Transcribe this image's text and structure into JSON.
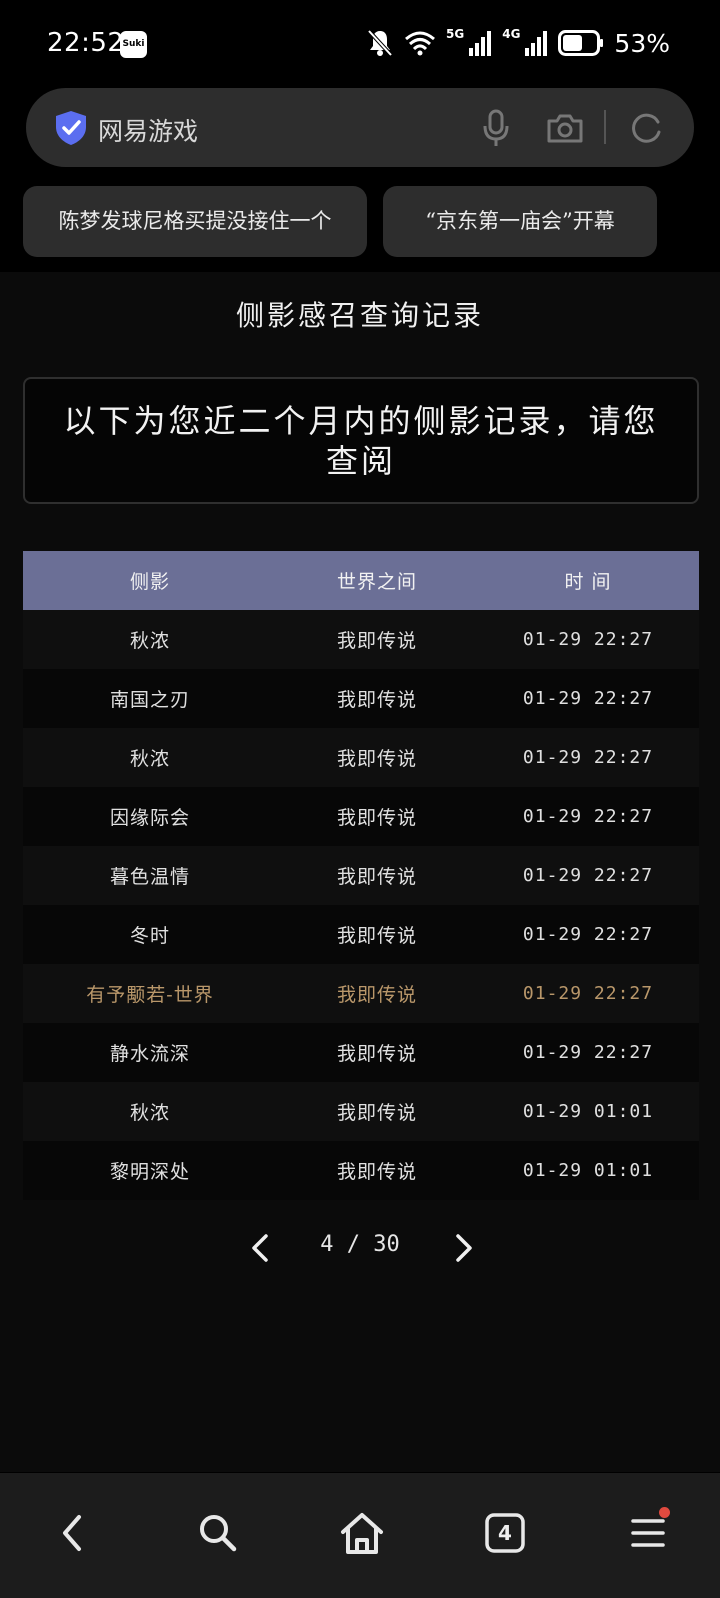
{
  "status_bar": {
    "time": "22:52",
    "app_badge": "Suki",
    "network_5g": "5G",
    "network_4g": "4G",
    "battery": "53%"
  },
  "search": {
    "text": "网易游戏"
  },
  "chips": [
    "陈梦发球尼格买提没接住一个",
    "“京东第一庙会”开幕"
  ],
  "page": {
    "title": "侧影感召查询记录",
    "notice": "以下为您近二个月内的侧影记录，请您查阅"
  },
  "table": {
    "headers": [
      "侧影",
      "世界之间",
      "时 间"
    ],
    "rows": [
      [
        "秋浓",
        "我即传说",
        "01-29 22:27"
      ],
      [
        "南国之刃",
        "我即传说",
        "01-29 22:27"
      ],
      [
        "秋浓",
        "我即传说",
        "01-29 22:27"
      ],
      [
        "因缘际会",
        "我即传说",
        "01-29 22:27"
      ],
      [
        "暮色温情",
        "我即传说",
        "01-29 22:27"
      ],
      [
        "冬时",
        "我即传说",
        "01-29 22:27"
      ],
      [
        "有予颙若-世界",
        "我即传说",
        "01-29 22:27"
      ],
      [
        "静水流深",
        "我即传说",
        "01-29 22:27"
      ],
      [
        "秋浓",
        "我即传说",
        "01-29 01:01"
      ],
      [
        "黎明深处",
        "我即传说",
        "01-29 01:01"
      ]
    ],
    "highlight_color": "#b9976a",
    "header_color": "#6b6f96"
  },
  "pagination": {
    "indicator": "4 / 30"
  },
  "bottom_nav": {
    "tab_count": "4",
    "icons": [
      "back-icon",
      "search-icon",
      "home-icon",
      "tabs-icon",
      "menu-icon"
    ]
  }
}
